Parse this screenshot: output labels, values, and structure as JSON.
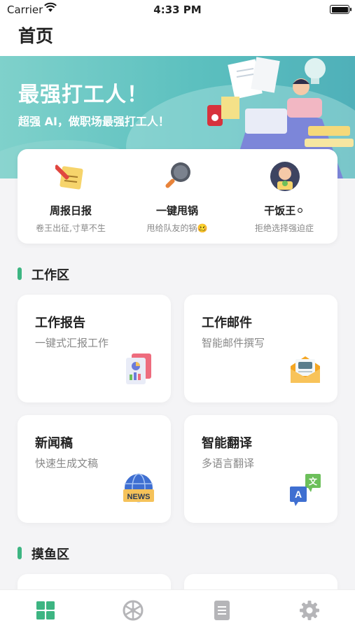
{
  "status": {
    "carrier": "Carrier",
    "time": "4:33 PM"
  },
  "nav": {
    "title": "首页"
  },
  "hero": {
    "headline": "最强打工人！",
    "tagline": "超强 AI，做职场最强打工人！"
  },
  "quick": [
    {
      "title": "周报日报",
      "subtitle": "卷王出征,寸草不生",
      "icon": "notepad-pencil-icon"
    },
    {
      "title": "一键甩锅",
      "subtitle": "甩给队友的锅🥴",
      "icon": "frying-pan-icon"
    },
    {
      "title": "干饭王⚪",
      "subtitle": "拒绝选择强迫症",
      "icon": "eating-person-icon"
    }
  ],
  "sections": {
    "work": "工作区",
    "fish": "摸鱼区"
  },
  "tiles": [
    {
      "title": "工作报告",
      "subtitle": "一键式汇报工作",
      "icon": "report-icon"
    },
    {
      "title": "工作邮件",
      "subtitle": "智能邮件撰写",
      "icon": "email-icon"
    },
    {
      "title": "新闻稿",
      "subtitle": "快速生成文稿",
      "icon": "news-globe-icon"
    },
    {
      "title": "智能翻译",
      "subtitle": "多语言翻译",
      "icon": "translate-icon"
    }
  ],
  "news_icon_text": "NEWS",
  "tabs": [
    {
      "icon": "grid-icon",
      "active": true
    },
    {
      "icon": "wheel-icon",
      "active": false
    },
    {
      "icon": "document-icon",
      "active": false
    },
    {
      "icon": "gear-icon",
      "active": false
    }
  ],
  "colors": {
    "accent": "#3db582",
    "hero": "#5cc0bf",
    "inactive": "#b5b5b8"
  }
}
